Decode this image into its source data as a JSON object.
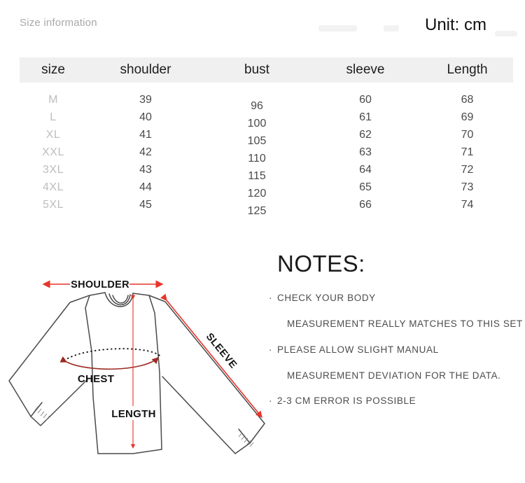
{
  "header": {
    "size_information_label": "Size information",
    "unit_label": "Unit: cm"
  },
  "table": {
    "columns": [
      "size",
      "shoulder",
      "bust",
      "sleeve",
      "Length"
    ],
    "rows": [
      {
        "size": "M",
        "shoulder": "39",
        "bust": "96",
        "sleeve": "60",
        "length": "68"
      },
      {
        "size": "L",
        "shoulder": "40",
        "bust": "100",
        "sleeve": "61",
        "length": "69"
      },
      {
        "size": "XL",
        "shoulder": "41",
        "bust": "105",
        "sleeve": "62",
        "length": "70"
      },
      {
        "size": "XXL",
        "shoulder": "42",
        "bust": "110",
        "sleeve": "63",
        "length": "71"
      },
      {
        "size": "3XL",
        "shoulder": "43",
        "bust": "115",
        "sleeve": "64",
        "length": "72"
      },
      {
        "size": "4XL",
        "shoulder": "44",
        "bust": "120",
        "sleeve": "65",
        "length": "73"
      },
      {
        "size": "5XL",
        "shoulder": "45",
        "bust": "125",
        "sleeve": "66",
        "length": "74"
      }
    ]
  },
  "diagram": {
    "labels": {
      "shoulder": "SHOULDER",
      "sleeve": "SLEEVE",
      "chest": "CHEST",
      "length": "LENGTH"
    },
    "colors": {
      "arrow": "#e8342a",
      "chest_arrow": "#9c2b23",
      "outline": "#4a4a4a"
    }
  },
  "notes": {
    "title": "NOTES:",
    "items": [
      {
        "line1": "CHECK YOUR BODY",
        "line2": "MEASUREMENT REALLY MATCHES TO THIS SET"
      },
      {
        "line1": "PLEASE ALLOW SLIGHT MANUAL",
        "line2": "MEASUREMENT DEVIATION FOR THE DATA."
      },
      {
        "line1": "2-3 CM ERROR IS POSSIBLE",
        "line2": ""
      }
    ]
  }
}
